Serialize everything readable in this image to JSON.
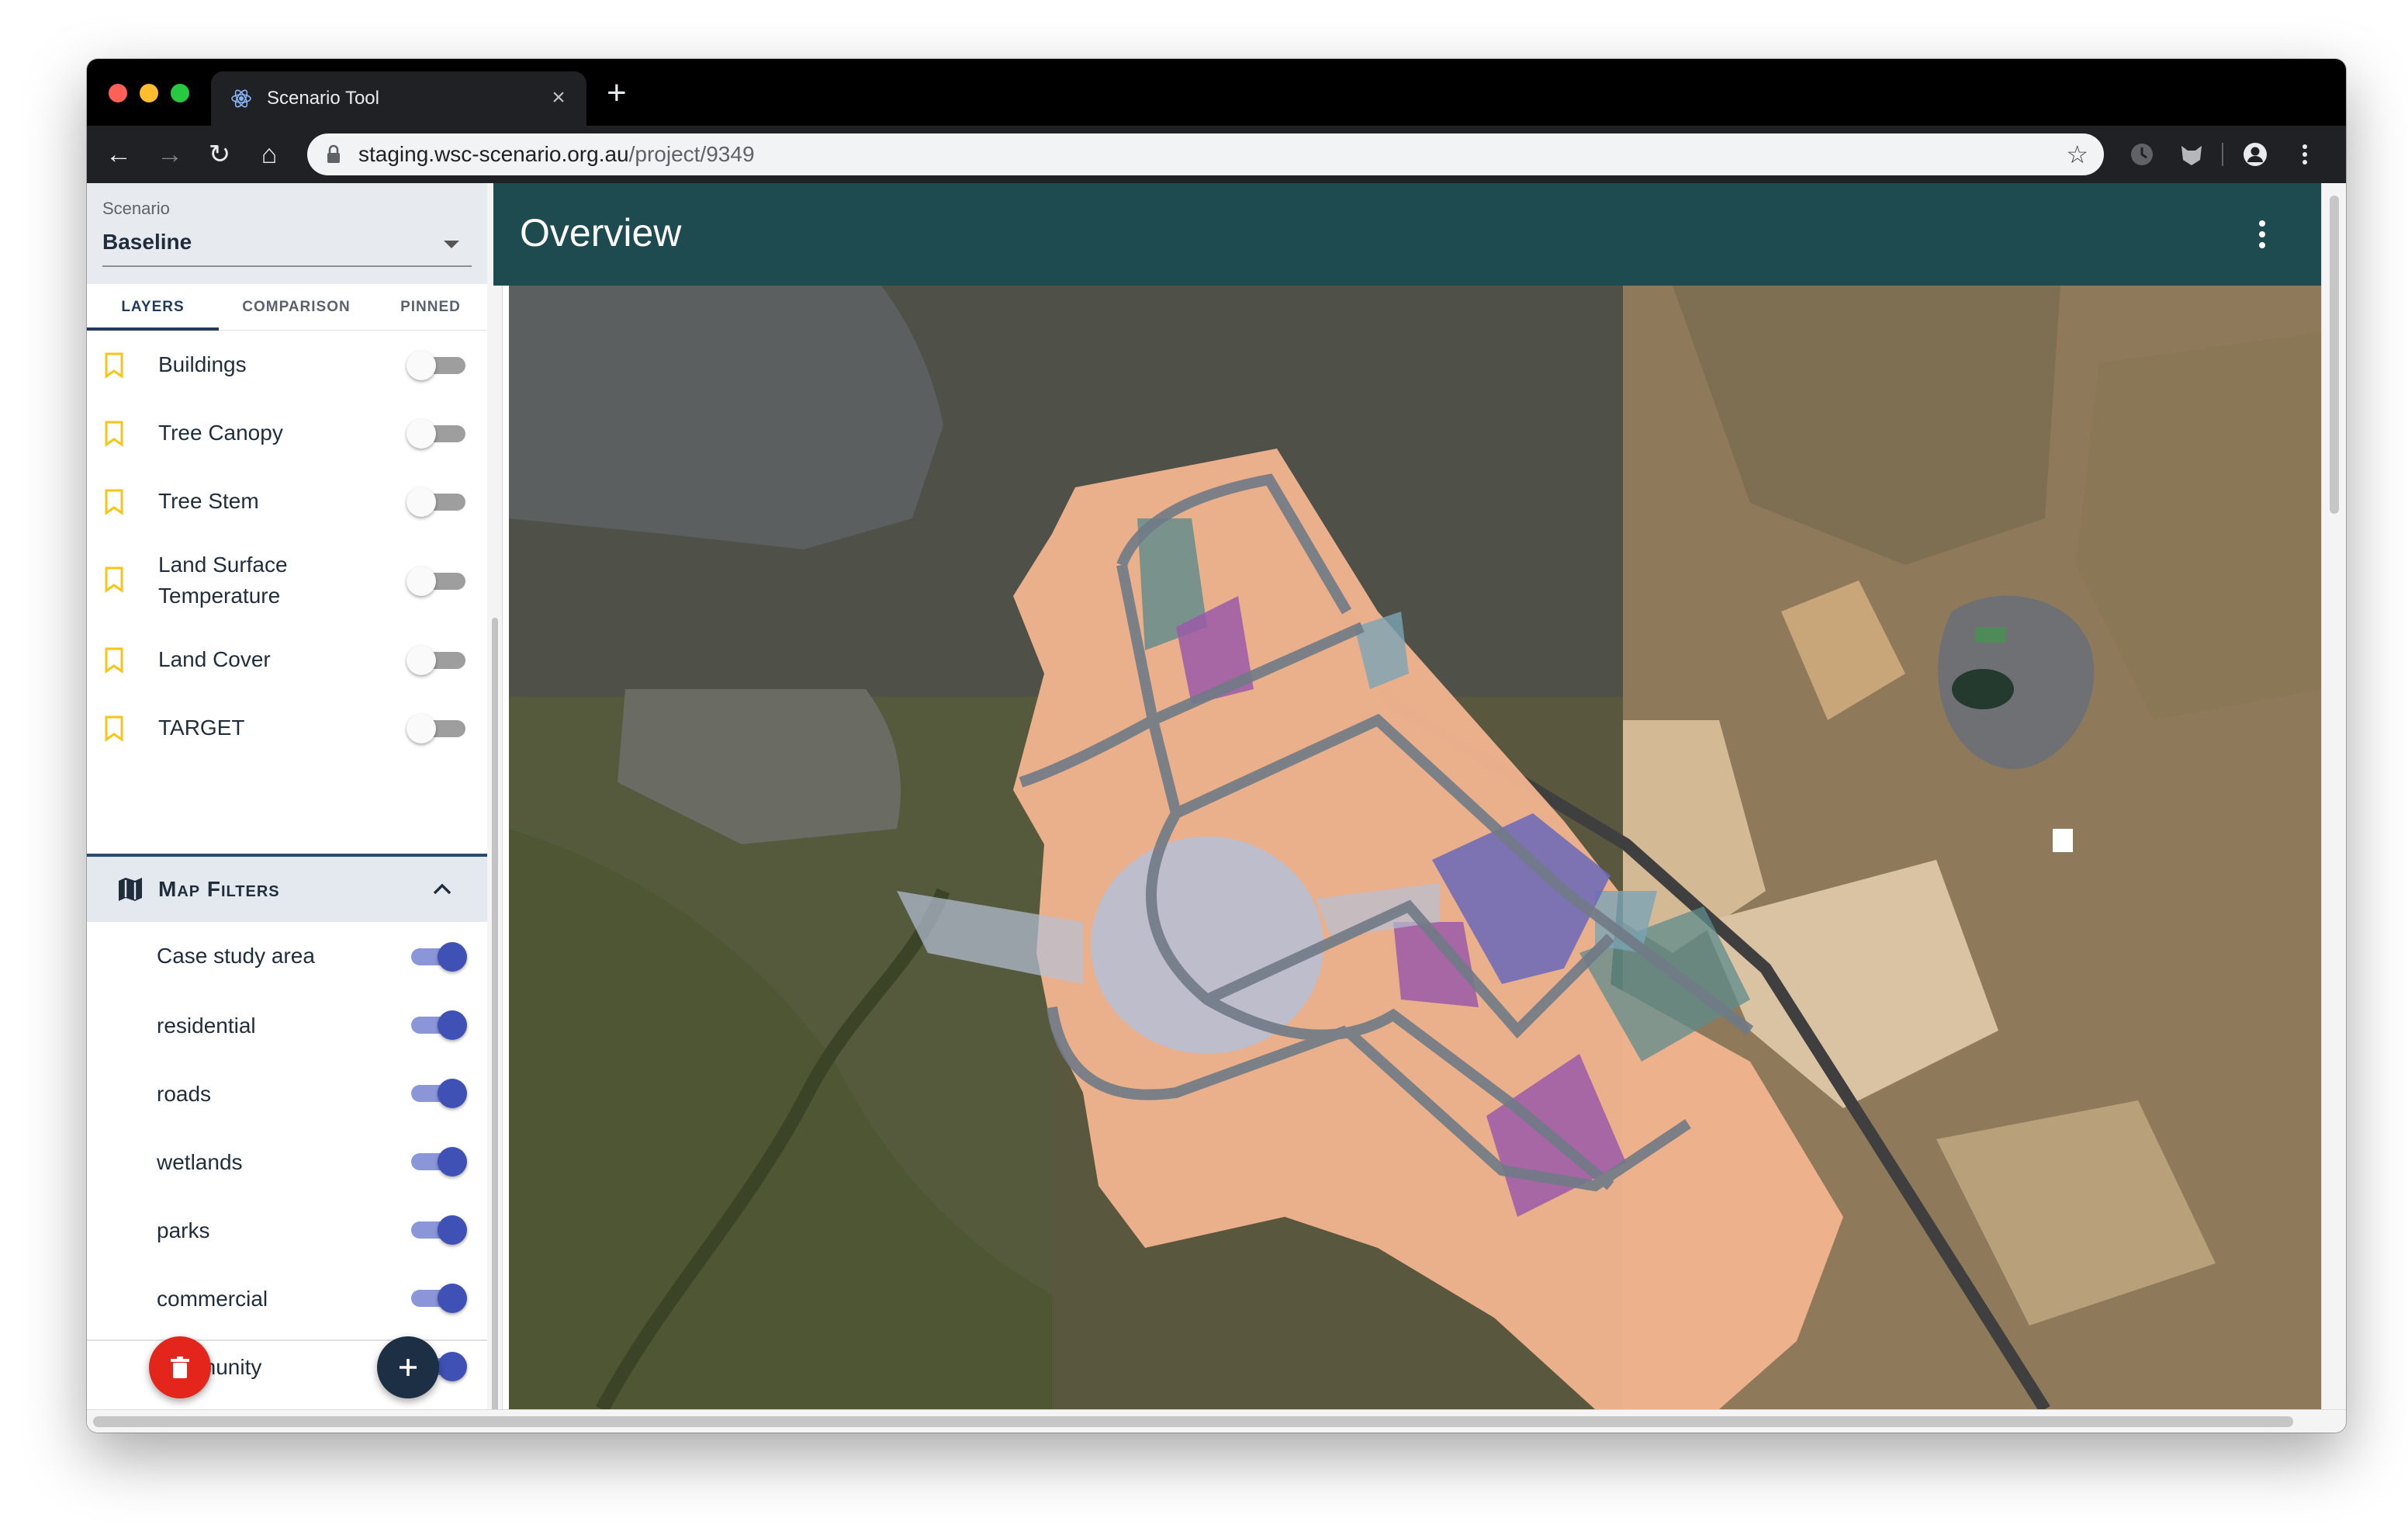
{
  "browser": {
    "tab_title": "Scenario Tool",
    "tab_close": "×",
    "new_tab": "+",
    "url_host": "staging.wsc-scenario.org.au",
    "url_path": "/project/9349"
  },
  "scenario": {
    "label": "Scenario",
    "value": "Baseline"
  },
  "panel_tabs": {
    "layers": "LAYERS",
    "comparison": "COMPARISON",
    "pinned": "PINNED"
  },
  "layers": [
    {
      "label": "Buildings",
      "on": false
    },
    {
      "label": "Tree Canopy",
      "on": false
    },
    {
      "label": "Tree Stem",
      "on": false
    },
    {
      "label": "Land Surface Temperature",
      "on": false
    },
    {
      "label": "Land Cover",
      "on": false
    },
    {
      "label": "TARGET",
      "on": false
    }
  ],
  "map_filters": {
    "title": "Map Filters",
    "items": [
      {
        "label": "Case study area",
        "on": true
      },
      {
        "label": "residential",
        "on": true
      },
      {
        "label": "roads",
        "on": true
      },
      {
        "label": "wetlands",
        "on": true
      },
      {
        "label": "parks",
        "on": true
      },
      {
        "label": "commercial",
        "on": true
      },
      {
        "label": "community",
        "on": true
      }
    ]
  },
  "main": {
    "title": "Overview"
  },
  "colors": {
    "header_bg": "#1e4b50",
    "toggle_on": "#3f51b5",
    "delete_fab": "#e3251b",
    "add_fab": "#1d2f45",
    "residential_fill": "#f2b48f",
    "commercial_fill": "#9a5aa8",
    "community_fill": "#6a68b8",
    "wetlands_fill": "#5d8c8c",
    "bookmark": "#f5c518"
  },
  "icons": {
    "favicon": "react-atom-icon",
    "lock": "lock-icon",
    "star": "star-icon",
    "delete": "trash-icon",
    "add": "plus-icon"
  }
}
